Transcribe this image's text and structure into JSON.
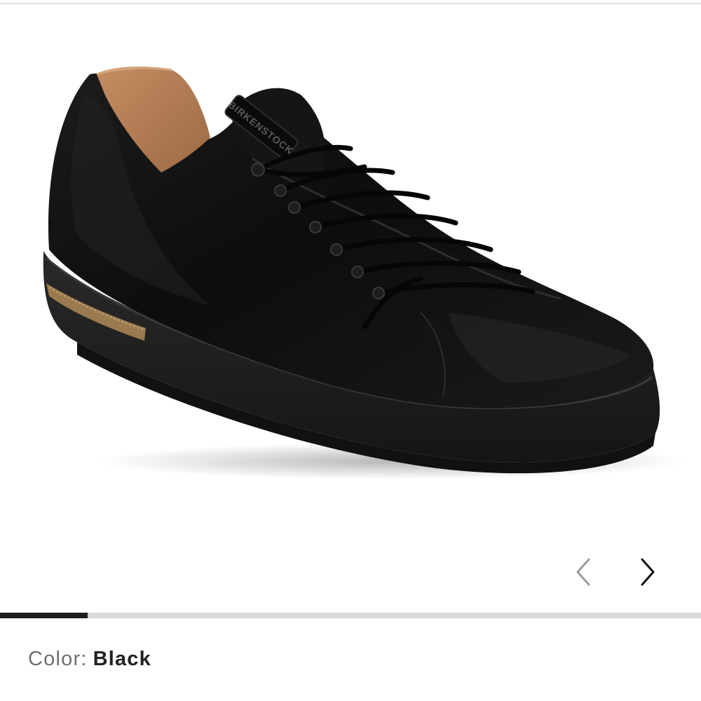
{
  "gallery": {
    "image_subject": "black calf hair low-top lace-up sneaker with black sole and cork trim",
    "brand_tag_text": "BIRKENSTOCK",
    "prev_icon": "chevron-left-icon",
    "next_icon": "chevron-right-icon",
    "progress_fraction": 0.125
  },
  "colors": {
    "shoe_upper": "#141414",
    "lining": "#b98157",
    "cork": "#9a7a4e",
    "progress_track": "#d9d9d9",
    "progress_fill": "#1e1e1e",
    "label_text": "#6f6f6f",
    "value_text": "#222222"
  },
  "color_selector": {
    "label": "Color:",
    "value": "Black"
  }
}
